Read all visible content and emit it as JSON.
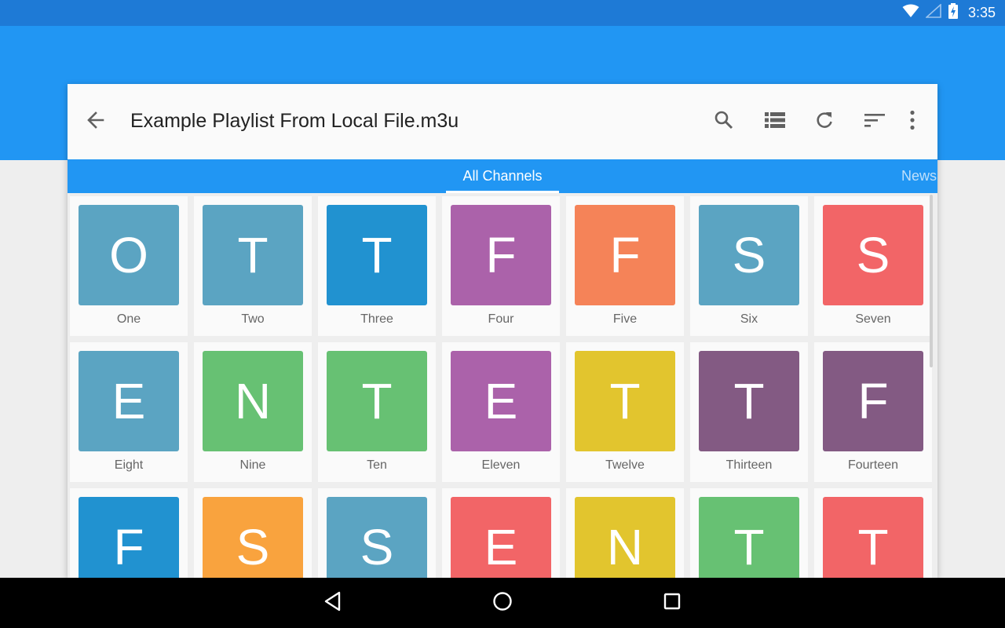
{
  "status_bar": {
    "time": "3:35",
    "icons": [
      "wifi-icon",
      "signal-icon",
      "battery-charging-icon"
    ]
  },
  "toolbar": {
    "title": "Example Playlist From Local File.m3u",
    "icons": [
      "back-arrow-icon",
      "search-icon",
      "list-view-icon",
      "refresh-icon",
      "sort-icon",
      "more-vert-icon"
    ]
  },
  "tabs": [
    {
      "label": "All Channels",
      "active": true
    },
    {
      "label": "News",
      "active": false
    }
  ],
  "channels": [
    {
      "letter": "O",
      "name": "One",
      "color": "#5ba4c2"
    },
    {
      "letter": "T",
      "name": "Two",
      "color": "#5ba4c2"
    },
    {
      "letter": "T",
      "name": "Three",
      "color": "#2192d0"
    },
    {
      "letter": "F",
      "name": "Four",
      "color": "#ab62aa"
    },
    {
      "letter": "F",
      "name": "Five",
      "color": "#f58358"
    },
    {
      "letter": "S",
      "name": "Six",
      "color": "#5ba4c2"
    },
    {
      "letter": "S",
      "name": "Seven",
      "color": "#f26567"
    },
    {
      "letter": "E",
      "name": "Eight",
      "color": "#5ba4c2"
    },
    {
      "letter": "N",
      "name": "Nine",
      "color": "#67c173"
    },
    {
      "letter": "T",
      "name": "Ten",
      "color": "#67c173"
    },
    {
      "letter": "E",
      "name": "Eleven",
      "color": "#ab62aa"
    },
    {
      "letter": "T",
      "name": "Twelve",
      "color": "#e2c52e"
    },
    {
      "letter": "T",
      "name": "Thirteen",
      "color": "#835a83"
    },
    {
      "letter": "F",
      "name": "Fourteen",
      "color": "#835a83"
    },
    {
      "letter": "F",
      "name": "",
      "color": "#2192d0"
    },
    {
      "letter": "S",
      "name": "",
      "color": "#f9a33e"
    },
    {
      "letter": "S",
      "name": "",
      "color": "#5ba4c2"
    },
    {
      "letter": "E",
      "name": "",
      "color": "#f26567"
    },
    {
      "letter": "N",
      "name": "",
      "color": "#e2c52e"
    },
    {
      "letter": "T",
      "name": "",
      "color": "#67c173"
    },
    {
      "letter": "T",
      "name": "",
      "color": "#f26567"
    }
  ],
  "nav_bar": {
    "icons": [
      "back-triangle-icon",
      "home-circle-icon",
      "recents-square-icon"
    ]
  }
}
